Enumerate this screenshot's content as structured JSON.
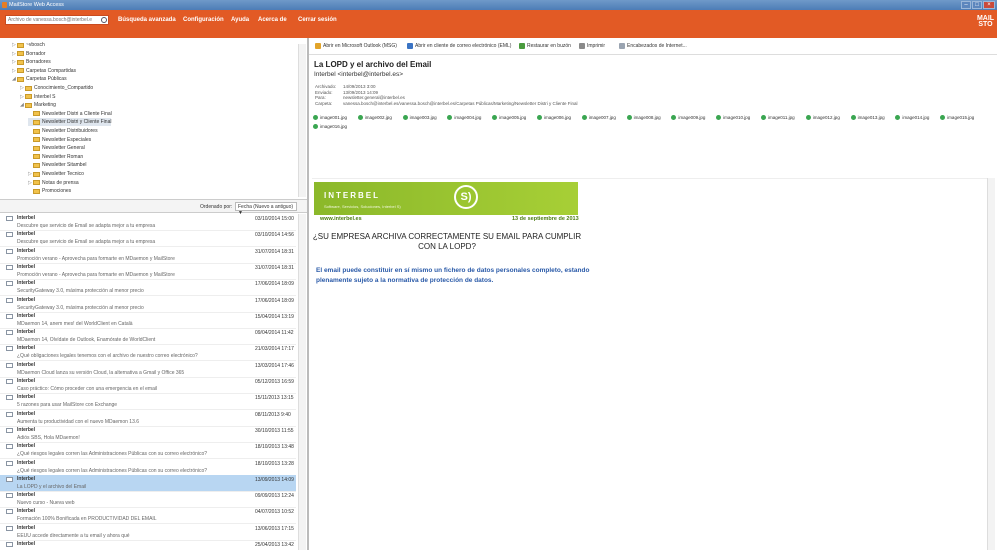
{
  "window": {
    "title": "MailStore Web Access"
  },
  "toolbar": {
    "search_placeholder": "Archivo de vanessa.bosch@interbel.e",
    "menu": [
      "Búsqueda avanzada",
      "Configuración",
      "Ayuda",
      "Acerca de",
      "Cerrar sesión"
    ],
    "brand": "MAIL STO"
  },
  "tree": [
    {
      "label": "~vbosch",
      "indent": 1,
      "exp": "▷"
    },
    {
      "label": "Borrador",
      "indent": 1,
      "exp": "▷"
    },
    {
      "label": "Borradores",
      "indent": 1,
      "exp": "▷"
    },
    {
      "label": "Carpetas Compartidas",
      "indent": 1,
      "exp": "▷"
    },
    {
      "label": "Carpetas Públicas",
      "indent": 1,
      "exp": "◢"
    },
    {
      "label": "Conocimiento_Compartido",
      "indent": 2,
      "exp": "▷"
    },
    {
      "label": "Interbel S",
      "indent": 2,
      "exp": "▷"
    },
    {
      "label": "Marketing",
      "indent": 2,
      "exp": "◢"
    },
    {
      "label": "Newsletter Distri a Cliente Final",
      "indent": 3,
      "exp": ""
    },
    {
      "label": "Newsletter Distri y Cliente Final",
      "indent": 3,
      "exp": "",
      "sel": true
    },
    {
      "label": "Newsletter Distribuidores",
      "indent": 3,
      "exp": ""
    },
    {
      "label": "Newsletter Especiales",
      "indent": 3,
      "exp": ""
    },
    {
      "label": "Newsletter General",
      "indent": 3,
      "exp": ""
    },
    {
      "label": "Newsletter Roman",
      "indent": 3,
      "exp": ""
    },
    {
      "label": "Newsletter Sitambel",
      "indent": 3,
      "exp": ""
    },
    {
      "label": "Newsletter Tecnico",
      "indent": 3,
      "exp": "▷"
    },
    {
      "label": "Notas de prensa",
      "indent": 3,
      "exp": "▷"
    },
    {
      "label": "Promociones",
      "indent": 3,
      "exp": ""
    }
  ],
  "sort": {
    "label": "Ordenado por:",
    "value": "Fecha (Nuevo a antiguo) ▼"
  },
  "messages": [
    {
      "from": "Interbel",
      "date": "03/10/2014 15:00",
      "subject": "Descubre que servicio de Email se adapta mejor a tu empresa"
    },
    {
      "from": "Interbel",
      "date": "03/10/2014 14:56",
      "subject": "Descubre que servicio de Email se adapta mejor a tu empresa"
    },
    {
      "from": "Interbel",
      "date": "31/07/2014 18:31",
      "subject": "Promoción verano - Aprovecha para formarte en MDaemon y MailStore"
    },
    {
      "from": "Interbel",
      "date": "31/07/2014 18:31",
      "subject": "Promoción verano - Aprovecha para formarte en MDaemon y MailStore"
    },
    {
      "from": "Interbel",
      "date": "17/06/2014 18:09",
      "subject": "SecurityGateway 3.0, máxima protección al menor precio"
    },
    {
      "from": "Interbel",
      "date": "17/06/2014 18:09",
      "subject": "SecurityGateway 3.0, máxima protección al menor precio"
    },
    {
      "from": "Interbel",
      "date": "15/04/2014 13:19",
      "subject": "MDaemon 14, anem mes! del WorldClient en Català"
    },
    {
      "from": "Interbel",
      "date": "09/04/2014 11:42",
      "subject": "MDaemon 14, Olvídate de Outlook, Enamórate de WorldClient"
    },
    {
      "from": "Interbel",
      "date": "21/03/2014 17:17",
      "subject": "¿Qué obligaciones legales tenemos con el archivo de nuestro correo electrónico?"
    },
    {
      "from": "Interbel",
      "date": "13/03/2014 17:46",
      "subject": "MDaemon Cloud lanza su versión Cloud, la alternativa a Gmail y Office 365"
    },
    {
      "from": "Interbel",
      "date": "05/12/2013 16:59",
      "subject": "Caso práctico: Cómo proceder con una emergencia en el email"
    },
    {
      "from": "Interbel",
      "date": "15/11/2013 13:15",
      "subject": "5 razones para usar MailStore con Exchange"
    },
    {
      "from": "Interbel",
      "date": "08/11/2013 9:40",
      "subject": "Aumenta tu productividad con el nuevo MDaemon 13.6"
    },
    {
      "from": "Interbel",
      "date": "30/10/2013 11:55",
      "subject": "Adiós SBS, Hola MDaemon!"
    },
    {
      "from": "Interbel",
      "date": "18/10/2013 13:48",
      "subject": "¿Qué riesgos legales corren las Administraciones Públicas con su correo electrónico?"
    },
    {
      "from": "Interbel",
      "date": "18/10/2013 13:28",
      "subject": "¿Qué riesgos legales corren las Administraciones Públicas con su correo electrónico?"
    },
    {
      "from": "Interbel",
      "date": "13/09/2013 14:09",
      "subject": "La LOPD y el archivo del Email",
      "sel": true
    },
    {
      "from": "Interbel",
      "date": "09/09/2013 12:24",
      "subject": "Nuevo curso - Nueva web"
    },
    {
      "from": "Interbel",
      "date": "04/07/2013 10:52",
      "subject": "Formación 100% Bonificada en PRODUCTIVIDAD DEL EMAIL"
    },
    {
      "from": "Interbel",
      "date": "13/06/2013 17:15",
      "subject": "EEUU accede directamente a tu email y ahora qué"
    },
    {
      "from": "Interbel",
      "date": "25/04/2013 13:42",
      "subject": ""
    }
  ],
  "preview": {
    "toolbar": [
      {
        "label": "Abrir en Microsoft Outlook (MSG)",
        "color": "#e2a42a"
      },
      {
        "label": "Abrir en cliente de correo electrónico (EML)",
        "color": "#3b74c4"
      },
      {
        "label": "Restaurar en buzón",
        "color": "#4a9b3e"
      },
      {
        "label": "Imprimir",
        "color": "#8a8a8a"
      },
      {
        "label": "Encabezados de Internet...",
        "color": "#9aa4b1"
      }
    ],
    "subject": "La LOPD y el archivo del Email",
    "sender": "Interbel <interbel@interbel.es>",
    "headers": [
      {
        "k": "Archivado:",
        "v": "14/09/2013 3:00"
      },
      {
        "k": "Enviado:",
        "v": "13/09/2013 14:09"
      },
      {
        "k": "Para:",
        "v": "newsletter.general@interbel.es"
      },
      {
        "k": "Carpeta:",
        "v": "vanessa.bosch@interbel.es/vanessa.bosch@interbel.es/Carpetas Públicas/Marketing/Newsletter Distri y Cliente Final"
      }
    ],
    "attachments": [
      "image001.jpg",
      "image002.jpg",
      "image003.jpg",
      "image004.jpg",
      "image005.jpg",
      "image006.jpg",
      "image007.jpg",
      "image008.jpg",
      "image009.jpg",
      "image010.jpg",
      "image011.jpg",
      "image012.jpg",
      "image013.jpg",
      "image014.jpg",
      "image015.jpg",
      "image016.jpg"
    ],
    "banner": {
      "brand": "INTERBEL",
      "tagline": "Software, Servicios, Soluciones, Interbel S)",
      "logo": "S)"
    },
    "site": "www.interbel.es",
    "date": "13 de septiembre de 2013",
    "headline": "¿SU EMPRESA ARCHIVA CORRECTAMENTE SU EMAIL PARA CUMPLIR CON LA LOPD?",
    "paragraph": "El email puede constituir en sí mismo un fichero de datos personales completo, estando plenamente sujeto a la normativa de protección de datos."
  }
}
